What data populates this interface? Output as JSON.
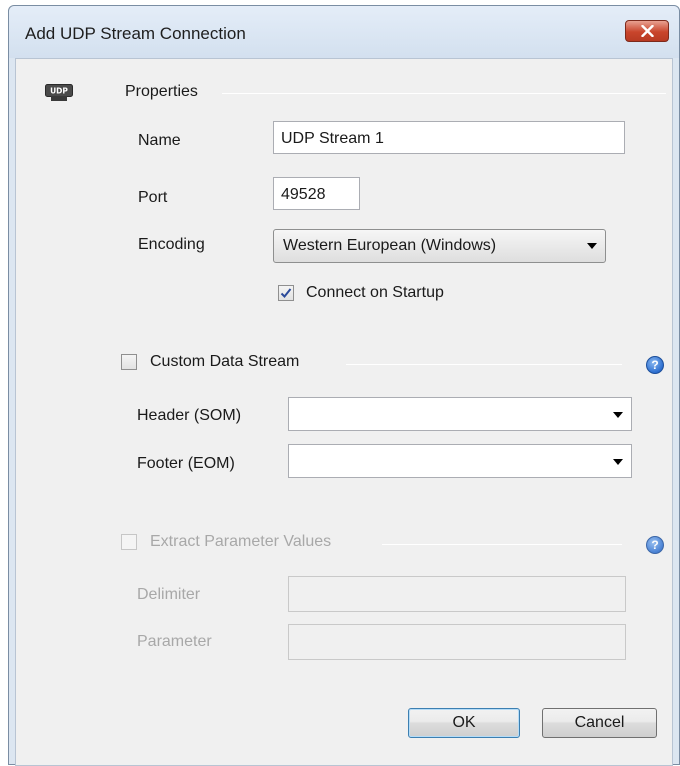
{
  "window": {
    "title": "Add UDP Stream Connection"
  },
  "icons": {
    "udp_icon_text": "UDP",
    "close": "close-icon",
    "help": "help-icon"
  },
  "properties": {
    "section_label": "Properties",
    "name_label": "Name",
    "name_value": "UDP Stream 1",
    "port_label": "Port",
    "port_value": "49528",
    "encoding_label": "Encoding",
    "encoding_value": "Western European (Windows)",
    "connect_on_startup_label": "Connect on Startup",
    "connect_on_startup_checked": true
  },
  "custom_data_stream": {
    "label": "Custom Data Stream",
    "checked": false,
    "header_label": "Header (SOM)",
    "header_value": "",
    "footer_label": "Footer (EOM)",
    "footer_value": ""
  },
  "extract_parameter_values": {
    "label": "Extract Parameter Values",
    "checked": false,
    "enabled": false,
    "delimiter_label": "Delimiter",
    "delimiter_value": "",
    "parameter_label": "Parameter",
    "parameter_value": ""
  },
  "buttons": {
    "ok_label": "OK",
    "cancel_label": "Cancel"
  },
  "colors": {
    "close_button": "#c9452c",
    "help_icon": "#2d6fd0",
    "default_button_border": "#3c7fb1"
  }
}
